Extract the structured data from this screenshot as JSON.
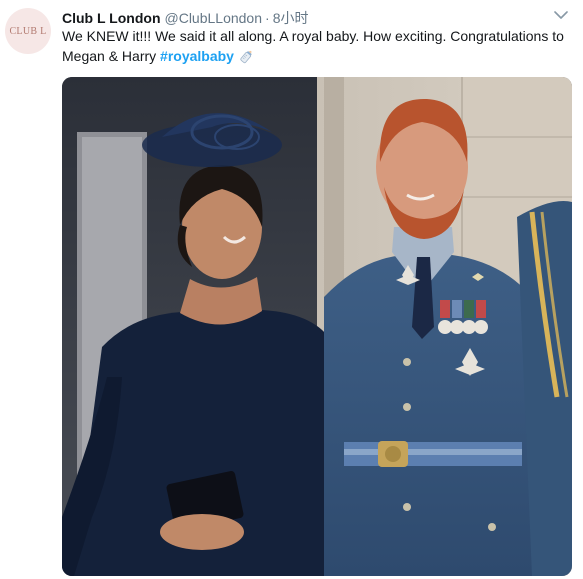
{
  "tweet": {
    "avatar_text": "CLUB L",
    "display_name": "Club L London",
    "handle": "@ClubLLondon",
    "separator": "·",
    "time": "8小时",
    "text_main": "We KNEW it!!! We said it all along. A royal baby. How exciting. Congratulations to Megan & Harry ",
    "hashtag": "#royalbaby",
    "icons": {
      "more": "chevron-down-icon",
      "emoji": "baby-bottle-icon"
    },
    "photo": {
      "description_label": "photo"
    }
  },
  "colors": {
    "link": "#1da1f2",
    "secondary_text": "#657786",
    "primary_text": "#14171a"
  }
}
